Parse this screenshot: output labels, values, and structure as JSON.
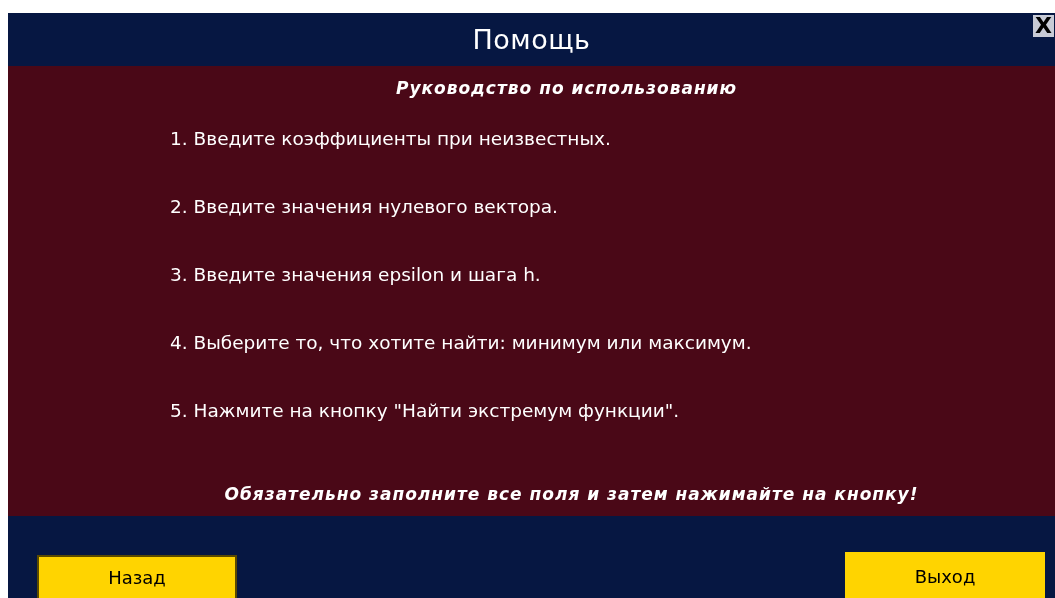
{
  "window": {
    "title": "Помощь",
    "close": "X"
  },
  "guide": {
    "heading": "Руководство по использованию",
    "steps": [
      "1. Введите коэффициенты при неизвестных.",
      "2. Введите значения нулевого вектора.",
      "3. Введите значения epsilon и шага h.",
      "4. Выберите то, что хотите найти: минимум или максимум.",
      "5. Нажмите на кнопку \"Найти экстремум функции\"."
    ],
    "warning": "Обязательно заполните все поля и затем нажимайте на кнопку!"
  },
  "buttons": [
    "Назад",
    "Выход"
  ]
}
